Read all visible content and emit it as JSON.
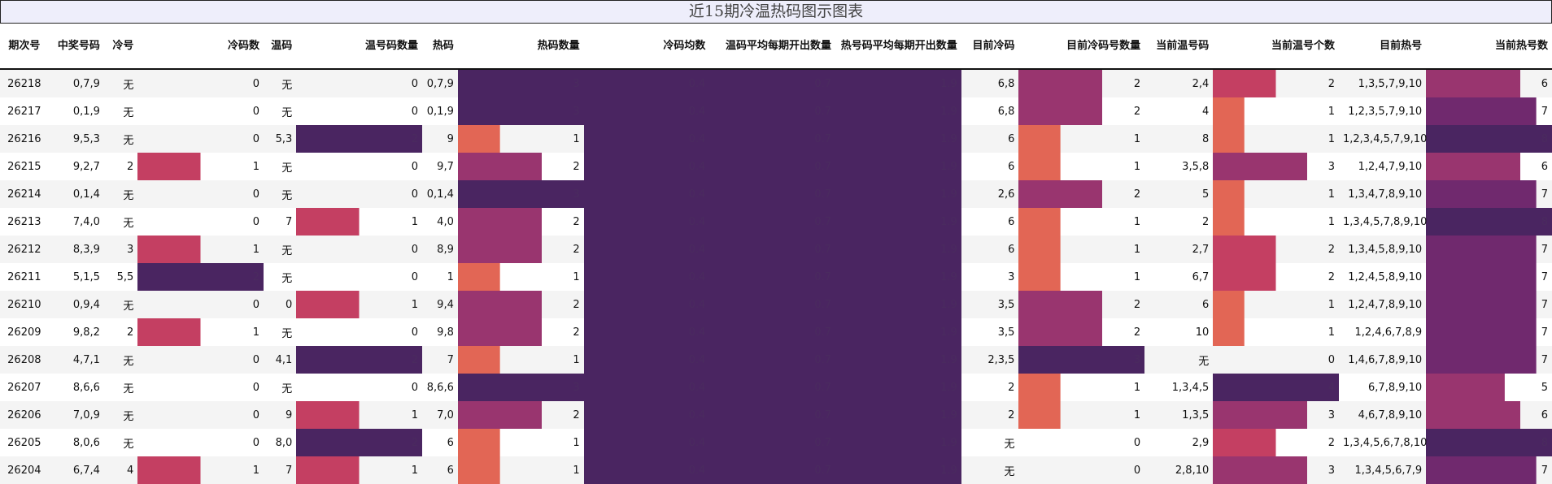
{
  "title": "近15期冷温热码图示图表",
  "columns": [
    {
      "key": "issue",
      "label": "期次号",
      "type": "text",
      "align": "c"
    },
    {
      "key": "code",
      "label": "中奖号码",
      "type": "text",
      "align": "r"
    },
    {
      "key": "cold",
      "label": "冷号",
      "type": "text",
      "align": "r"
    },
    {
      "key": "cold_n",
      "label": "冷码数",
      "type": "bar",
      "max": 2
    },
    {
      "key": "warm",
      "label": "温码",
      "type": "text",
      "align": "r"
    },
    {
      "key": "warm_n",
      "label": "温号码数量",
      "type": "bar",
      "max": 2
    },
    {
      "key": "hot",
      "label": "热码",
      "type": "text",
      "align": "r"
    },
    {
      "key": "hot_n",
      "label": "热码数量",
      "type": "bar",
      "max": 3
    },
    {
      "key": "cold_avg",
      "label": "冷码均数",
      "type": "bar",
      "max": 0.4
    },
    {
      "key": "warm_avg",
      "label": "温码平均每期开出数量",
      "type": "bar",
      "max": 0.7
    },
    {
      "key": "hot_avg",
      "label": "热号码平均每期开出数量",
      "type": "bar",
      "max": 1.9
    },
    {
      "key": "cur_cold",
      "label": "目前冷码",
      "type": "text",
      "align": "r"
    },
    {
      "key": "cur_cold_n",
      "label": "目前冷码号数量",
      "type": "bar",
      "max": 3
    },
    {
      "key": "cur_warm",
      "label": "当前温号码",
      "type": "text",
      "align": "r"
    },
    {
      "key": "cur_warm_n",
      "label": "当前温号个数",
      "type": "bar",
      "max": 4
    },
    {
      "key": "cur_hot",
      "label": "目前热号",
      "type": "text",
      "align": "r"
    },
    {
      "key": "cur_hot_n",
      "label": "当前热号数",
      "type": "bar",
      "max": 8
    }
  ],
  "rows": [
    {
      "issue": "26218",
      "code": "0,7,9",
      "cold": "无",
      "cold_n": 0,
      "warm": "无",
      "warm_n": 0,
      "hot": "0,7,9",
      "hot_n": 3,
      "cold_avg": 0.4,
      "warm_avg": 0.7,
      "hot_avg": 1.9,
      "cur_cold": "6,8",
      "cur_cold_n": 2,
      "cur_warm": "2,4",
      "cur_warm_n": 2,
      "cur_hot": "1,3,5,7,9,10",
      "cur_hot_n": 6
    },
    {
      "issue": "26217",
      "code": "0,1,9",
      "cold": "无",
      "cold_n": 0,
      "warm": "无",
      "warm_n": 0,
      "hot": "0,1,9",
      "hot_n": 3,
      "cold_avg": 0.4,
      "warm_avg": 0.7,
      "hot_avg": 1.9,
      "cur_cold": "6,8",
      "cur_cold_n": 2,
      "cur_warm": "4",
      "cur_warm_n": 1,
      "cur_hot": "1,2,3,5,7,9,10",
      "cur_hot_n": 7
    },
    {
      "issue": "26216",
      "code": "9,5,3",
      "cold": "无",
      "cold_n": 0,
      "warm": "5,3",
      "warm_n": 2,
      "hot": "9",
      "hot_n": 1,
      "cold_avg": 0.4,
      "warm_avg": 0.7,
      "hot_avg": 1.9,
      "cur_cold": "6",
      "cur_cold_n": 1,
      "cur_warm": "8",
      "cur_warm_n": 1,
      "cur_hot": "1,2,3,4,5,7,9,10",
      "cur_hot_n": 8
    },
    {
      "issue": "26215",
      "code": "9,2,7",
      "cold": "2",
      "cold_n": 1,
      "warm": "无",
      "warm_n": 0,
      "hot": "9,7",
      "hot_n": 2,
      "cold_avg": 0.4,
      "warm_avg": 0.7,
      "hot_avg": 1.9,
      "cur_cold": "6",
      "cur_cold_n": 1,
      "cur_warm": "3,5,8",
      "cur_warm_n": 3,
      "cur_hot": "1,2,4,7,9,10",
      "cur_hot_n": 6
    },
    {
      "issue": "26214",
      "code": "0,1,4",
      "cold": "无",
      "cold_n": 0,
      "warm": "无",
      "warm_n": 0,
      "hot": "0,1,4",
      "hot_n": 3,
      "cold_avg": 0.4,
      "warm_avg": 0.7,
      "hot_avg": 1.9,
      "cur_cold": "2,6",
      "cur_cold_n": 2,
      "cur_warm": "5",
      "cur_warm_n": 1,
      "cur_hot": "1,3,4,7,8,9,10",
      "cur_hot_n": 7
    },
    {
      "issue": "26213",
      "code": "7,4,0",
      "cold": "无",
      "cold_n": 0,
      "warm": "7",
      "warm_n": 1,
      "hot": "4,0",
      "hot_n": 2,
      "cold_avg": 0.4,
      "warm_avg": 0.7,
      "hot_avg": 1.9,
      "cur_cold": "6",
      "cur_cold_n": 1,
      "cur_warm": "2",
      "cur_warm_n": 1,
      "cur_hot": "1,3,4,5,7,8,9,10",
      "cur_hot_n": 8
    },
    {
      "issue": "26212",
      "code": "8,3,9",
      "cold": "3",
      "cold_n": 1,
      "warm": "无",
      "warm_n": 0,
      "hot": "8,9",
      "hot_n": 2,
      "cold_avg": 0.4,
      "warm_avg": 0.7,
      "hot_avg": 1.9,
      "cur_cold": "6",
      "cur_cold_n": 1,
      "cur_warm": "2,7",
      "cur_warm_n": 2,
      "cur_hot": "1,3,4,5,8,9,10",
      "cur_hot_n": 7
    },
    {
      "issue": "26211",
      "code": "5,1,5",
      "cold": "5,5",
      "cold_n": 2,
      "warm": "无",
      "warm_n": 0,
      "hot": "1",
      "hot_n": 1,
      "cold_avg": 0.4,
      "warm_avg": 0.7,
      "hot_avg": 1.9,
      "cur_cold": "3",
      "cur_cold_n": 1,
      "cur_warm": "6,7",
      "cur_warm_n": 2,
      "cur_hot": "1,2,4,5,8,9,10",
      "cur_hot_n": 7
    },
    {
      "issue": "26210",
      "code": "0,9,4",
      "cold": "无",
      "cold_n": 0,
      "warm": "0",
      "warm_n": 1,
      "hot": "9,4",
      "hot_n": 2,
      "cold_avg": 0.4,
      "warm_avg": 0.7,
      "hot_avg": 1.9,
      "cur_cold": "3,5",
      "cur_cold_n": 2,
      "cur_warm": "6",
      "cur_warm_n": 1,
      "cur_hot": "1,2,4,7,8,9,10",
      "cur_hot_n": 7
    },
    {
      "issue": "26209",
      "code": "9,8,2",
      "cold": "2",
      "cold_n": 1,
      "warm": "无",
      "warm_n": 0,
      "hot": "9,8",
      "hot_n": 2,
      "cold_avg": 0.4,
      "warm_avg": 0.7,
      "hot_avg": 1.9,
      "cur_cold": "3,5",
      "cur_cold_n": 2,
      "cur_warm": "10",
      "cur_warm_n": 1,
      "cur_hot": "1,2,4,6,7,8,9",
      "cur_hot_n": 7
    },
    {
      "issue": "26208",
      "code": "4,7,1",
      "cold": "无",
      "cold_n": 0,
      "warm": "4,1",
      "warm_n": 2,
      "hot": "7",
      "hot_n": 1,
      "cold_avg": 0.4,
      "warm_avg": 0.7,
      "hot_avg": 1.9,
      "cur_cold": "2,3,5",
      "cur_cold_n": 3,
      "cur_warm": "无",
      "cur_warm_n": 0,
      "cur_hot": "1,4,6,7,8,9,10",
      "cur_hot_n": 7
    },
    {
      "issue": "26207",
      "code": "8,6,6",
      "cold": "无",
      "cold_n": 0,
      "warm": "无",
      "warm_n": 0,
      "hot": "8,6,6",
      "hot_n": 3,
      "cold_avg": 0.4,
      "warm_avg": 0.7,
      "hot_avg": 1.9,
      "cur_cold": "2",
      "cur_cold_n": 1,
      "cur_warm": "1,3,4,5",
      "cur_warm_n": 4,
      "cur_hot": "6,7,8,9,10",
      "cur_hot_n": 5
    },
    {
      "issue": "26206",
      "code": "7,0,9",
      "cold": "无",
      "cold_n": 0,
      "warm": "9",
      "warm_n": 1,
      "hot": "7,0",
      "hot_n": 2,
      "cold_avg": 0.4,
      "warm_avg": 0.7,
      "hot_avg": 1.9,
      "cur_cold": "2",
      "cur_cold_n": 1,
      "cur_warm": "1,3,5",
      "cur_warm_n": 3,
      "cur_hot": "4,6,7,8,9,10",
      "cur_hot_n": 6
    },
    {
      "issue": "26205",
      "code": "8,0,6",
      "cold": "无",
      "cold_n": 0,
      "warm": "8,0",
      "warm_n": 2,
      "hot": "6",
      "hot_n": 1,
      "cold_avg": 0.4,
      "warm_avg": 0.7,
      "hot_avg": 1.9,
      "cur_cold": "无",
      "cur_cold_n": 0,
      "cur_warm": "2,9",
      "cur_warm_n": 2,
      "cur_hot": "1,3,4,5,6,7,8,10",
      "cur_hot_n": 8
    },
    {
      "issue": "26204",
      "code": "6,7,4",
      "cold": "4",
      "cold_n": 1,
      "warm": "7",
      "warm_n": 1,
      "hot": "6",
      "hot_n": 1,
      "cold_avg": 0.4,
      "warm_avg": 0.7,
      "hot_avg": 1.9,
      "cur_cold": "无",
      "cur_cold_n": 0,
      "cur_warm": "2,8,10",
      "cur_warm_n": 3,
      "cur_hot": "1,3,4,5,6,7,9",
      "cur_hot_n": 7
    }
  ],
  "palette": {
    "bar_highest": "#4a2561",
    "bar_high": "#70296e",
    "bar_mid": "#99356f",
    "bar_low": "#c43f62",
    "bar_lowest": "#e26655",
    "header_border": "#111111",
    "title_background": "#eeeefb"
  }
}
